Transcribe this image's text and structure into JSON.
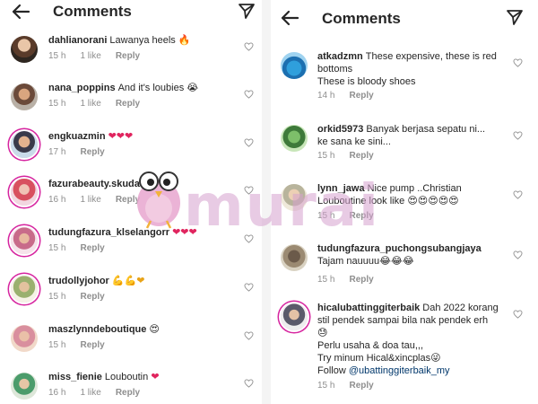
{
  "header": {
    "title": "Comments"
  },
  "colors": {
    "accent": "#d6249f",
    "muted": "#8e8e8e",
    "watermark": "#d5a0cd"
  },
  "icons": {
    "back": "arrow-left-icon",
    "send": "paper-plane-icon",
    "like": "heart-outline-icon"
  },
  "watermark": {
    "text": "murai"
  },
  "left_comments": [
    {
      "username": "dahlianorani",
      "text": "Lawanya heels",
      "emoji": "🔥",
      "time": "15 h",
      "likes": "1 like",
      "reply": "Reply"
    },
    {
      "username": "nana_poppins",
      "text": "And it's loubies",
      "emoji": "😭",
      "time": "15 h",
      "likes": "1 like",
      "reply": "Reply"
    },
    {
      "username": "engkuazmin",
      "text": "",
      "emoji": "❤❤❤",
      "time": "17 h",
      "likes": "",
      "reply": "Reply"
    },
    {
      "username": "fazurabeauty.skudai",
      "text": "",
      "emoji": "",
      "time": "16 h",
      "likes": "1 like",
      "reply": "Reply"
    },
    {
      "username": "tudungfazura_klselangorr",
      "text": "",
      "emoji": "❤❤❤",
      "time": "15 h",
      "likes": "",
      "reply": "Reply"
    },
    {
      "username": "trudollyjohor",
      "text": "",
      "emoji": "💪💪❤",
      "time": "15 h",
      "likes": "",
      "reply": "Reply"
    },
    {
      "username": "maszlynndeboutique",
      "text": "",
      "emoji": "😍",
      "time": "15 h",
      "likes": "",
      "reply": "Reply"
    },
    {
      "username": "miss_fienie",
      "text": "Louboutin",
      "emoji": "❤",
      "time": "16 h",
      "likes": "1 like",
      "reply": "Reply"
    }
  ],
  "right_comments": [
    {
      "username": "atkadzmn",
      "text": "These expensive, these is red bottoms",
      "line2": "These is bloody shoes",
      "time": "14 h",
      "reply": "Reply"
    },
    {
      "username": "orkid5973",
      "text": "Banyak berjasa sepatu ni...",
      "line2": "ke sana ke sini...",
      "time": "15 h",
      "reply": "Reply"
    },
    {
      "username": "lynn_jawa",
      "text": "Nice pump ..Christian",
      "line2": "Louboutine look like",
      "emoji": "😍😍😍😍😍",
      "time": "15 h",
      "reply": "Reply"
    },
    {
      "username": "tudungfazura_puchongsubangjaya",
      "text": "",
      "line2": "Tajam nauuuu",
      "emoji": "😂😂😂",
      "time": "15 h",
      "reply": "Reply"
    },
    {
      "username": "hicalubattinggiterbaik",
      "text": "Dah 2022 korang",
      "line2": "stil pendek sampai bila nak pendek erh",
      "emoji": "😓",
      "line3": "Perlu usaha & doa tau,,,",
      "line4": "Try minum Hical&xincplas",
      "emoji2": "😜",
      "line5_prefix": "Follow",
      "mention": "@ubattinggiterbaik_my",
      "time": "15 h",
      "reply": "Reply"
    }
  ]
}
